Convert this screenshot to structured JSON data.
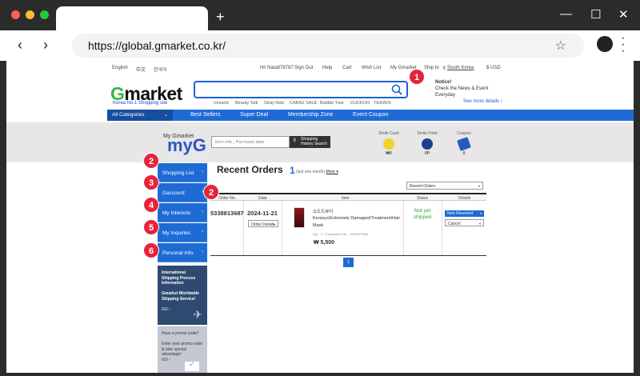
{
  "browser": {
    "url": "https://global.gmarket.co.kr/"
  },
  "utility_bar": {
    "lang_en": "English",
    "lang_zh": "中文",
    "lang_ko": "한국어",
    "greeting": "Hi! Nata878787",
    "sign_out": "Sign Out",
    "help": "Help",
    "cart": "Cart",
    "wish_list": "Wish List",
    "my_gmarket": "My Gmarket",
    "ship_to_label": "Ship to",
    "ship_to_value": "South Korea",
    "currency": "$ USD"
  },
  "header": {
    "logo_g": "G",
    "logo_rest": "market",
    "logo_sub": "Korea No.1 Shopping site",
    "search_value": "",
    "keywords": [
      "romand",
      "Beauty Talk",
      "Stray Kids",
      "CARAZ SALE",
      "Bubble Tree",
      "CUCKOO",
      "TEAZEN"
    ],
    "notice_title": "Notice!",
    "notice_body": "Check the News & Event Everyday",
    "see_more": "See more details"
  },
  "nav": {
    "all_categories": "All Categories",
    "items": [
      "Best Sellers",
      "Super Deal",
      "Membership Zone",
      "Event Coupon"
    ]
  },
  "myg": {
    "my_gmarket": "My Gmarket",
    "logo": "myG",
    "search_placeholder": "Item info., Purchase date.",
    "search_btn": "Shopping History Search",
    "smile_cash_label": "Smile Cash",
    "smile_cash_value": "₩0",
    "smile_point_label": "Smile Point",
    "smile_point_value": "0P",
    "coupon_label": "Coupon",
    "coupon_value": "0"
  },
  "sidebar": {
    "items": [
      "Shopping List",
      "Gaccount",
      "My Interests",
      "My Inquiries",
      "Personal Info."
    ],
    "banner1_title": "International Shipping Process Information",
    "banner1_sub": "Gmarket Worldwide Shipping Service!",
    "banner1_go": "GO",
    "banner2_title": "Have a promo code?",
    "banner2_body": "Enter your promo code & take special advantage!",
    "banner2_go": "GO"
  },
  "badges": [
    "1",
    "2",
    "2",
    "3",
    "4",
    "5",
    "6"
  ],
  "orders": {
    "title": "Recent Orders",
    "count": "1",
    "period": "(last one month)",
    "more": "More",
    "filter": "Recent Orders",
    "headers": [
      "Order No.",
      "Date",
      "Item",
      "Status",
      "Details"
    ],
    "order_no": "5338813687",
    "date": "2024-11-21",
    "order_details": "Order Details",
    "seller": "쇼도도뷰티",
    "item_name": "Kerasys/Extremely Damaged/Treatment/Hair Mask",
    "qty_line": "Qty : 1 / Transaction No. : 4229527968",
    "price": "₩ 5,500",
    "status": "Not yet shipped",
    "item_received": "Item Received",
    "cancel": "Cancel",
    "page": "1"
  },
  "colors": {
    "brand_blue": "#1e6bd6",
    "gmarket_green": "#39b54a",
    "badge_red": "#e5243b",
    "status_green": "#2fa82f"
  }
}
